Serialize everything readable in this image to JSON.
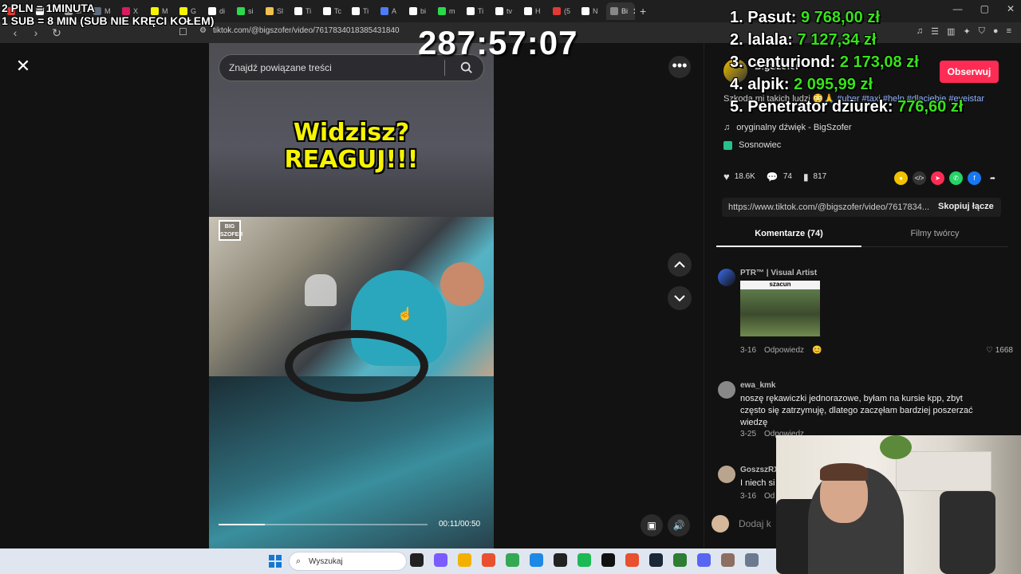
{
  "browser": {
    "tabs": [
      {
        "label": "",
        "color": "#e53935"
      },
      {
        "label": "",
        "color": "#ffffff"
      },
      {
        "label": "ul",
        "color": "#9e9e9e"
      },
      {
        "label": "M",
        "color": "#5e6b7a"
      },
      {
        "label": "X",
        "color": "#d81b60"
      },
      {
        "label": "M",
        "color": "#f6f400"
      },
      {
        "label": "G",
        "color": "#f6f400"
      },
      {
        "label": "di",
        "color": "#ffffff"
      },
      {
        "label": "si",
        "color": "#2bd94d"
      },
      {
        "label": "Sl",
        "color": "#f2c14e"
      },
      {
        "label": "Ti",
        "color": "#ffffff"
      },
      {
        "label": "Tc",
        "color": "#ffffff"
      },
      {
        "label": "Ti",
        "color": "#ffffff"
      },
      {
        "label": "A",
        "color": "#4f7cf5"
      },
      {
        "label": "bi",
        "color": "#ffffff"
      },
      {
        "label": "m",
        "color": "#2bd94d"
      },
      {
        "label": "Ti",
        "color": "#ffffff"
      },
      {
        "label": "tv",
        "color": "#ffffff"
      },
      {
        "label": "H",
        "color": "#ffffff"
      },
      {
        "label": "(5",
        "color": "#e53935"
      },
      {
        "label": "N",
        "color": "#ffffff"
      }
    ],
    "active_tab_label": "Bi",
    "url": "tiktok.com/@bigszofer/video/7617834018385431840"
  },
  "search": {
    "placeholder": "Znajdź powiązane treści"
  },
  "video": {
    "overlay_line1": "Widzisz?",
    "overlay_line2": "REAGUJ!!!",
    "watermark": "BIG SZOFER",
    "time": "00:11/00:50",
    "progress_percent": 22
  },
  "post": {
    "author": "BigSzofer",
    "follow_label": "Obserwuj",
    "description": "Szkoda mi takich ludzi 😳🙏",
    "hashtags": "#uber #taxi #help #dlaciebie #eveistar",
    "sound": "oryginalny dźwięk - BigSzofer",
    "location": "Sosnowiec",
    "likes": "18.6K",
    "comments_count": "74",
    "saves": "817",
    "link": "https://www.tiktok.com/@bigszofer/video/7617834...",
    "copy_label": "Skopiuj łącze"
  },
  "tabs": {
    "comments": "Komentarze (74)",
    "creator_videos": "Filmy twórcy"
  },
  "comments": [
    {
      "user": "PTR™ | Visual Artist",
      "gif_label": "szacun",
      "date": "3-16",
      "reply": "Odpowiedz",
      "likes": "1668"
    },
    {
      "user": "ewa_kmk",
      "text": "noszę rękawiczki jednorazowe, byłam na kursie kpp, zbyt często się zatrzymuję, dlatego zaczęłam bardziej poszerzać wiedzę",
      "date": "3-25",
      "reply": "Odpowiedz"
    },
    {
      "user": "GoszszRX",
      "text": "I niech si",
      "date": "3-16",
      "reply": "Od"
    }
  ],
  "add_comment_placeholder": "Dodaj k",
  "stream": {
    "line1": "2 PLN = 1MINUTA",
    "line2": "1 SUB = 8 MIN (SUB NIE KRĘCI KOŁEM)",
    "timer": "287:57:07",
    "leaderboard": [
      {
        "rank": "1.",
        "name": "Pasut:",
        "amount": "9 768,00 zł"
      },
      {
        "rank": "2.",
        "name": "lalala:",
        "amount": "7 127,34 zł"
      },
      {
        "rank": "3.",
        "name": "centuriond:",
        "amount": "2 173,08 zł"
      },
      {
        "rank": "4.",
        "name": "alpik:",
        "amount": "2 095,99 zł"
      },
      {
        "rank": "5.",
        "name": "Penetrator dziurek:",
        "amount": "776,60 zł"
      }
    ]
  },
  "taskbar": {
    "search_placeholder": "Wyszukaj",
    "icons": [
      "#222222",
      "#7a5cff",
      "#f2b100",
      "#e8502f",
      "#34a853",
      "#1e88e5",
      "#222222",
      "#1db954",
      "#111111",
      "#e8502f",
      "#1b2838",
      "#2e7d32",
      "#5865f2",
      "#8d6e63",
      "#6b7a8f"
    ]
  }
}
